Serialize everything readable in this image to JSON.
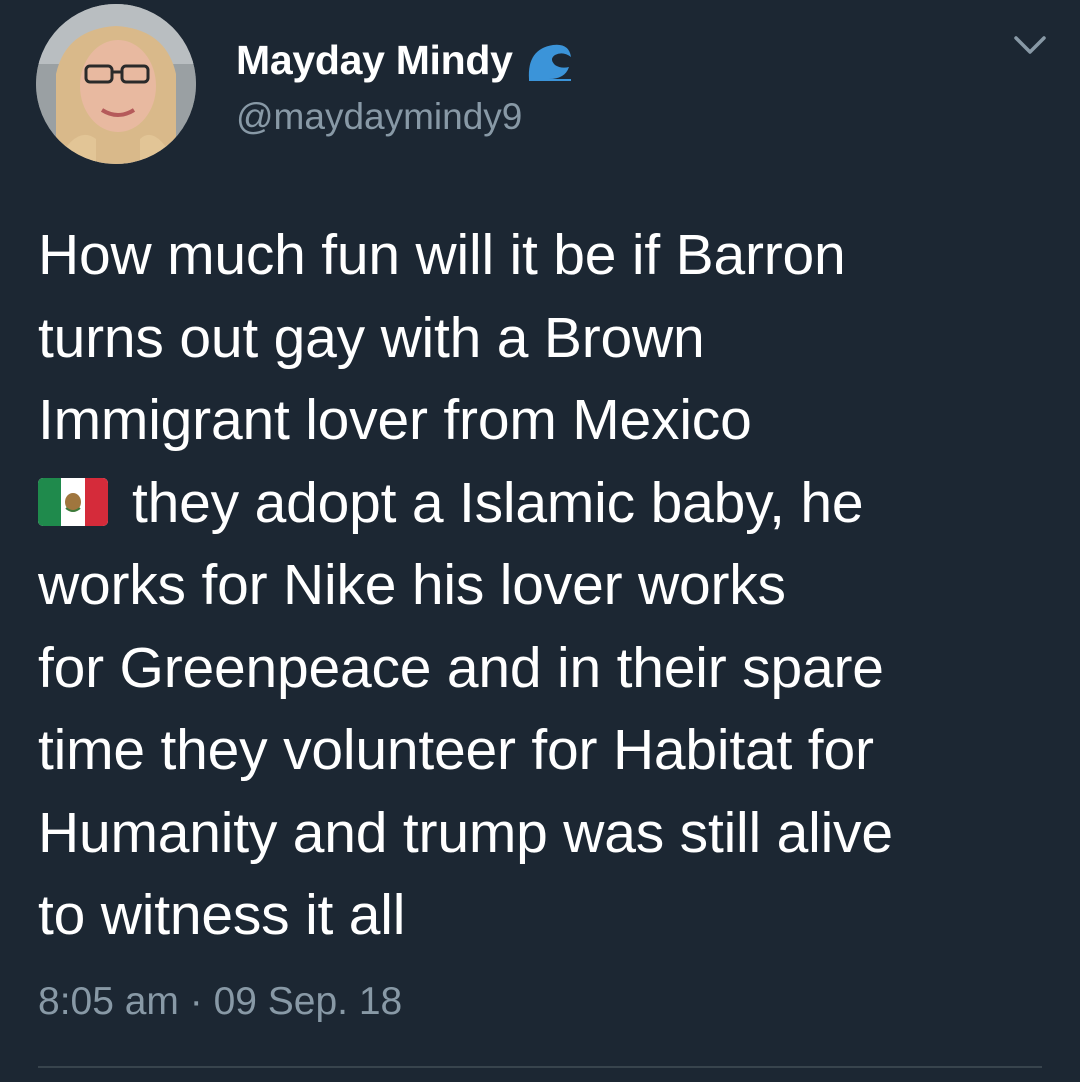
{
  "tweet": {
    "display_name": "Mayday Mindy",
    "handle": "@maydaymindy9",
    "name_emoji": "wave-icon",
    "menu_icon": "chevron-down-icon",
    "avatar_icon": "avatar",
    "text_lines": [
      "How much fun will it be if Barron",
      "turns out gay with a Brown",
      "Immigrant lover from Mexico",
      "they adopt a Islamic baby, he",
      "works for Nike his lover works",
      "for Greenpeace and in their spare",
      "time they volunteer for Habitat for",
      "Humanity and trump was still alive",
      "to witness it all"
    ],
    "flag_emoji": "mexico-flag-icon",
    "timestamp": "8:05 am · 09 Sep. 18"
  },
  "colors": {
    "background": "#1c2733",
    "text": "#ffffff",
    "secondary_text": "#8899a6",
    "wave": "#3b94d9",
    "divider": "#38444d"
  }
}
